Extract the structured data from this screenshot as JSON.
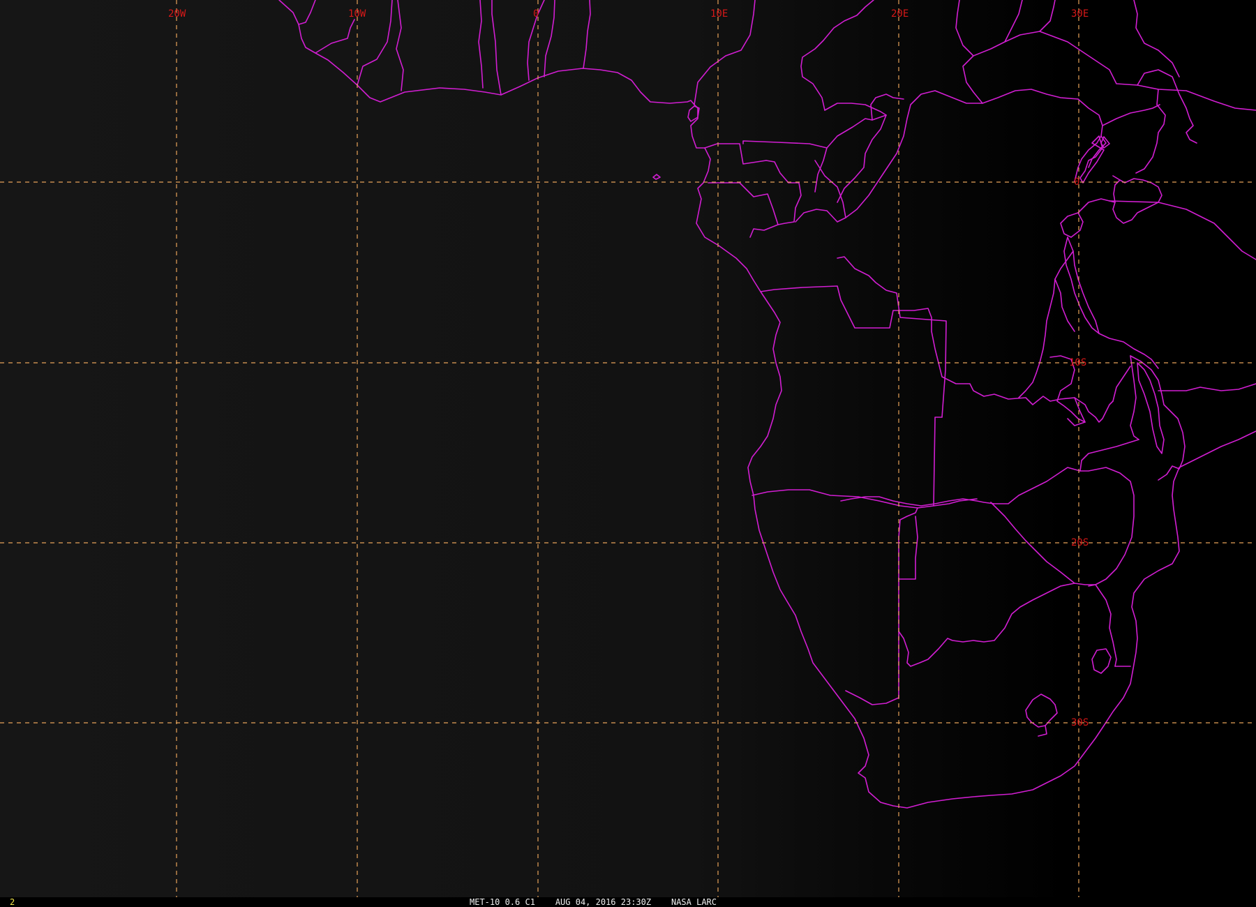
{
  "image": {
    "satellite": "MET-10",
    "channel": "0.6 C1",
    "date": "AUG 04, 2016",
    "time": "23:30Z",
    "credit": "NASA LARC",
    "frame_number": "2",
    "caption": "MET-10 0.6 C1    AUG 04, 2016 23:30Z    NASA LARC"
  },
  "grid": {
    "longitude_labels": [
      "20W",
      "10W",
      "0",
      "10E",
      "20E",
      "30E"
    ],
    "latitude_labels": [
      "0",
      "10S",
      "20S",
      "30S"
    ]
  },
  "colors": {
    "background": "#000000",
    "coastline": "#d21ed2",
    "gridline": "#e8a35a",
    "label": "#d81818",
    "frame_number": "#f4e84a"
  }
}
